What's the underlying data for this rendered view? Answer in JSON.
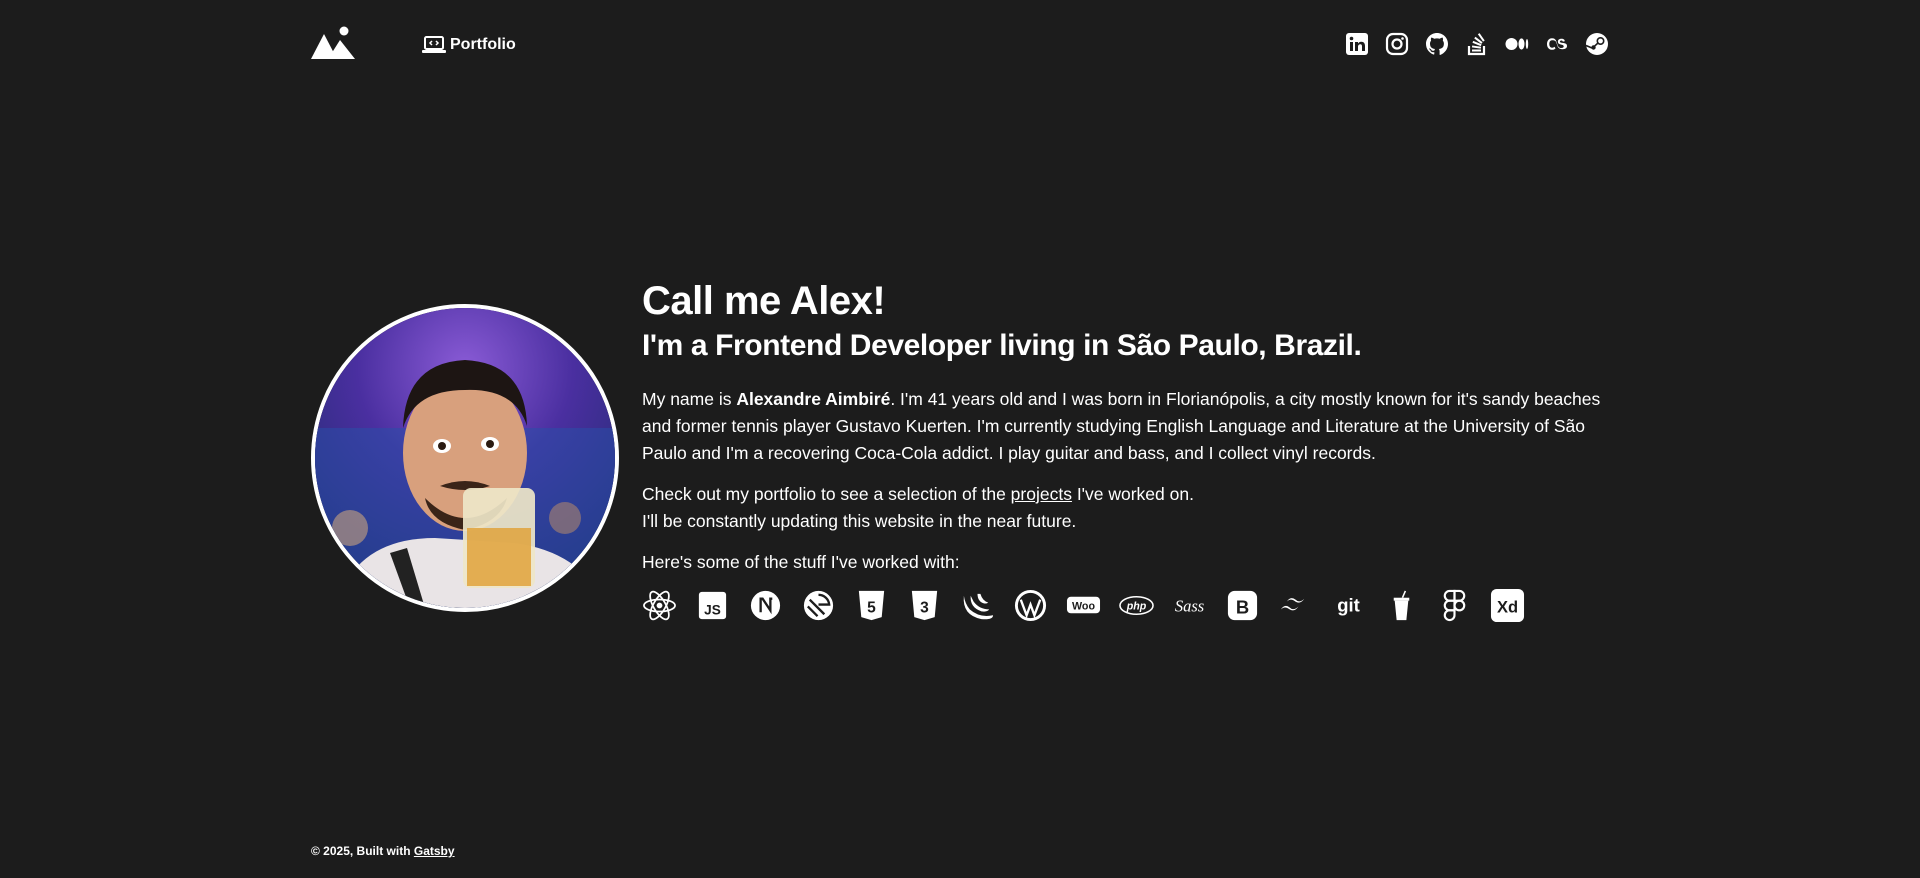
{
  "header": {
    "logo_icon": "mountains-logo-icon",
    "nav": {
      "portfolio_label": "Portfolio",
      "portfolio_icon": "laptop-code-icon"
    },
    "socials": [
      {
        "name": "linkedin-icon"
      },
      {
        "name": "instagram-icon"
      },
      {
        "name": "github-icon"
      },
      {
        "name": "stackoverflow-icon"
      },
      {
        "name": "medium-icon"
      },
      {
        "name": "lastfm-icon"
      },
      {
        "name": "steam-icon"
      }
    ]
  },
  "hero": {
    "title": "Call me Alex!",
    "subtitle": "I'm a Frontend Developer living in São Paulo, Brazil.",
    "bio": {
      "prefix": "My name is ",
      "name": "Alexandre Aimbiré",
      "rest": ". I'm 41 years old and I was born in Florianópolis, a city mostly known for it's sandy beaches and former tennis player Gustavo Kuerten. I'm currently studying English Language and Literature at the University of São Paulo and I'm a recovering Coca-Cola addict. I play guitar and bass, and I collect vinyl records."
    },
    "portfolio_line": {
      "prefix": "Check out my portfolio to see a selection of the ",
      "link": "projects",
      "suffix": " I've worked on."
    },
    "update_line": "I'll be constantly updating this website in the near future.",
    "stack_intro": "Here's some of the stuff I've worked with:",
    "stack": [
      "react-icon",
      "javascript-icon",
      "nextjs-icon",
      "gatsby-icon",
      "html5-icon",
      "css3-icon",
      "jquery-icon",
      "wordpress-icon",
      "woocommerce-icon",
      "php-icon",
      "sass-icon",
      "bootstrap-icon",
      "tailwind-icon",
      "git-icon",
      "gulp-icon",
      "figma-icon",
      "adobe-xd-icon"
    ]
  },
  "footer": {
    "text": "© 2025, Built with ",
    "link": "Gatsby"
  },
  "colors": {
    "background": "#1c1c1c",
    "text": "#ffffff"
  }
}
